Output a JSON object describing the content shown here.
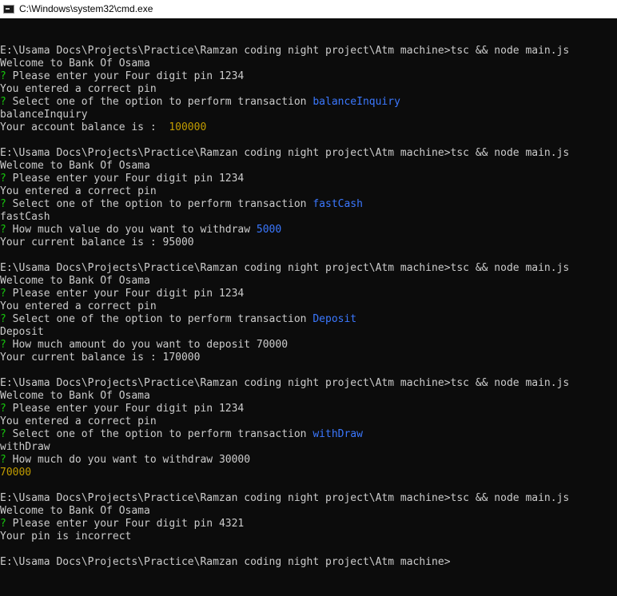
{
  "window": {
    "title": "C:\\Windows\\system32\\cmd.exe",
    "app_icon": "console-icon"
  },
  "colors": {
    "background": "#0c0c0c",
    "text": "#cccccc",
    "question_mark": "#16c60c",
    "answer": "#3b78ff",
    "number": "#c19c00"
  },
  "console": {
    "lines": [
      {
        "type": "blank"
      },
      {
        "type": "text",
        "text": "E:\\Usama Docs\\Projects\\Practice\\Ramzan coding night project\\Atm machine>tsc && node main.js"
      },
      {
        "type": "text",
        "text": "Welcome to Bank Of Osama"
      },
      {
        "type": "prompt",
        "mark": "?",
        "text": " Please enter your Four digit pin ",
        "answer": "1234",
        "answer_color": "default"
      },
      {
        "type": "text",
        "text": "You entered a correct pin"
      },
      {
        "type": "prompt",
        "mark": "?",
        "text": " Select one of the option to perform transaction ",
        "answer": "balanceInquiry",
        "answer_color": "blue"
      },
      {
        "type": "text",
        "text": "balanceInquiry"
      },
      {
        "type": "valued",
        "text": "Your account balance is :  ",
        "value": "100000"
      },
      {
        "type": "blank"
      },
      {
        "type": "text",
        "text": "E:\\Usama Docs\\Projects\\Practice\\Ramzan coding night project\\Atm machine>tsc && node main.js"
      },
      {
        "type": "text",
        "text": "Welcome to Bank Of Osama"
      },
      {
        "type": "prompt",
        "mark": "?",
        "text": " Please enter your Four digit pin ",
        "answer": "1234",
        "answer_color": "default"
      },
      {
        "type": "text",
        "text": "You entered a correct pin"
      },
      {
        "type": "prompt",
        "mark": "?",
        "text": " Select one of the option to perform transaction ",
        "answer": "fastCash",
        "answer_color": "blue"
      },
      {
        "type": "text",
        "text": "fastCash"
      },
      {
        "type": "prompt",
        "mark": "?",
        "text": " How much value do you want to withdraw ",
        "answer": "5000",
        "answer_color": "blue"
      },
      {
        "type": "text",
        "text": "Your current balance is : 95000"
      },
      {
        "type": "blank"
      },
      {
        "type": "text",
        "text": "E:\\Usama Docs\\Projects\\Practice\\Ramzan coding night project\\Atm machine>tsc && node main.js"
      },
      {
        "type": "text",
        "text": "Welcome to Bank Of Osama"
      },
      {
        "type": "prompt",
        "mark": "?",
        "text": " Please enter your Four digit pin ",
        "answer": "1234",
        "answer_color": "default"
      },
      {
        "type": "text",
        "text": "You entered a correct pin"
      },
      {
        "type": "prompt",
        "mark": "?",
        "text": " Select one of the option to perform transaction ",
        "answer": "Deposit",
        "answer_color": "blue"
      },
      {
        "type": "text",
        "text": "Deposit"
      },
      {
        "type": "prompt",
        "mark": "?",
        "text": " How much amount do you want to deposit ",
        "answer": "70000",
        "answer_color": "default"
      },
      {
        "type": "text",
        "text": "Your current balance is : 170000"
      },
      {
        "type": "blank"
      },
      {
        "type": "text",
        "text": "E:\\Usama Docs\\Projects\\Practice\\Ramzan coding night project\\Atm machine>tsc && node main.js"
      },
      {
        "type": "text",
        "text": "Welcome to Bank Of Osama"
      },
      {
        "type": "prompt",
        "mark": "?",
        "text": " Please enter your Four digit pin ",
        "answer": "1234",
        "answer_color": "default"
      },
      {
        "type": "text",
        "text": "You entered a correct pin"
      },
      {
        "type": "prompt",
        "mark": "?",
        "text": " Select one of the option to perform transaction ",
        "answer": "withDraw",
        "answer_color": "blue"
      },
      {
        "type": "text",
        "text": "withDraw"
      },
      {
        "type": "prompt",
        "mark": "?",
        "text": " How much do you want to withdraw ",
        "answer": "30000",
        "answer_color": "default"
      },
      {
        "type": "valued",
        "text": "",
        "value": "70000"
      },
      {
        "type": "blank"
      },
      {
        "type": "text",
        "text": "E:\\Usama Docs\\Projects\\Practice\\Ramzan coding night project\\Atm machine>tsc && node main.js"
      },
      {
        "type": "text",
        "text": "Welcome to Bank Of Osama"
      },
      {
        "type": "prompt",
        "mark": "?",
        "text": " Please enter your Four digit pin ",
        "answer": "4321",
        "answer_color": "default"
      },
      {
        "type": "text",
        "text": "Your pin is incorrect"
      },
      {
        "type": "blank"
      },
      {
        "type": "text",
        "text": "E:\\Usama Docs\\Projects\\Practice\\Ramzan coding night project\\Atm machine>"
      }
    ]
  }
}
